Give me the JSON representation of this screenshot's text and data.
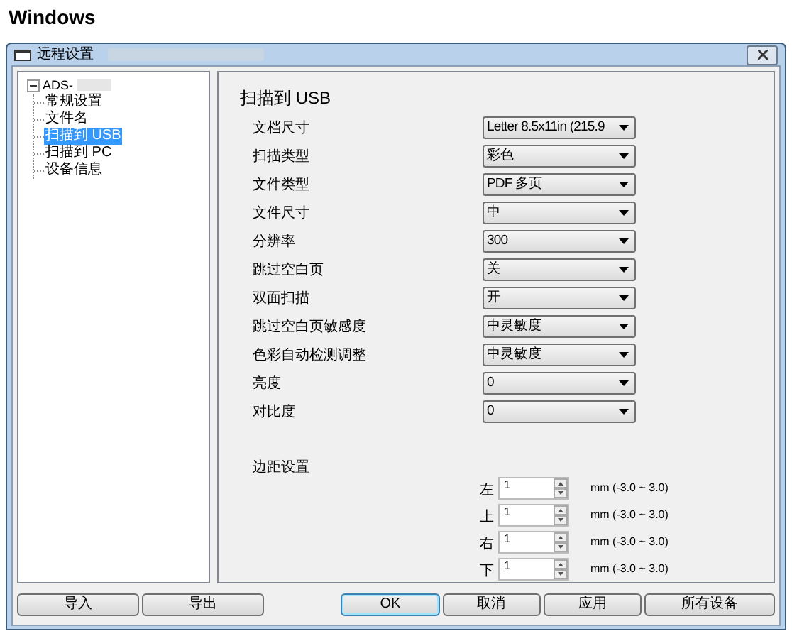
{
  "page_heading": "Windows",
  "window": {
    "title": "远程设置"
  },
  "tree": {
    "label": "ADS-",
    "expanded": true,
    "children": [
      {
        "label": "常规设置",
        "selected": false
      },
      {
        "label": "文件名",
        "selected": false
      },
      {
        "label": "扫描到 USB",
        "selected": true
      },
      {
        "label": "扫描到 PC",
        "selected": false
      },
      {
        "label": "设备信息",
        "selected": false
      }
    ]
  },
  "panel": {
    "title": "扫描到 USB",
    "settings": [
      {
        "label": "文档尺寸",
        "value": "Letter 8.5x11in (215.9"
      },
      {
        "label": "扫描类型",
        "value": "彩色"
      },
      {
        "label": "文件类型",
        "value": "PDF 多页"
      },
      {
        "label": "文件尺寸",
        "value": "中"
      },
      {
        "label": "分辨率",
        "value": "300"
      },
      {
        "label": "跳过空白页",
        "value": "关"
      },
      {
        "label": "双面扫描",
        "value": "开"
      },
      {
        "label": "跳过空白页敏感度",
        "value": "中灵敏度"
      },
      {
        "label": "色彩自动检测调整",
        "value": "中灵敏度"
      },
      {
        "label": "亮度",
        "value": "0"
      },
      {
        "label": "对比度",
        "value": "0"
      }
    ],
    "margin": {
      "title": "边距设置",
      "fields": [
        {
          "label": "左",
          "value": "1",
          "range": "mm (-3.0 ~ 3.0)"
        },
        {
          "label": "上",
          "value": "1",
          "range": "mm (-3.0 ~ 3.0)"
        },
        {
          "label": "右",
          "value": "1",
          "range": "mm (-3.0 ~ 3.0)"
        },
        {
          "label": "下",
          "value": "1",
          "range": "mm (-3.0 ~ 3.0)"
        }
      ]
    }
  },
  "buttons_left": [
    "导入",
    "导出"
  ],
  "buttons_right": [
    {
      "label": "OK",
      "default": true
    },
    {
      "label": "取消",
      "default": false
    },
    {
      "label": "应用",
      "default": false
    },
    {
      "label": "所有设备",
      "default": false
    }
  ]
}
